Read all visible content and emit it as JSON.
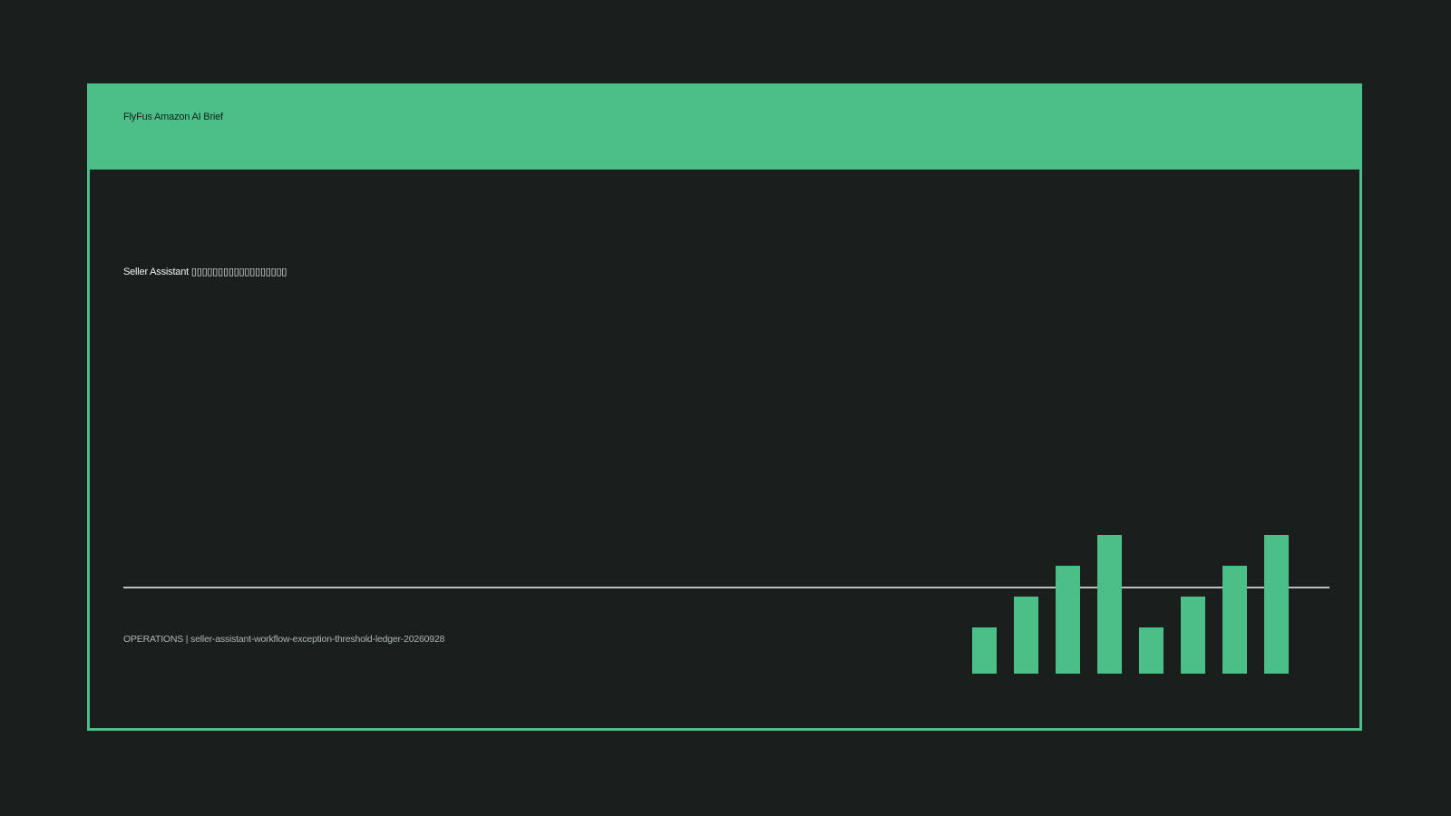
{
  "header": {
    "brand": "FlyFus Amazon AI Brief"
  },
  "main": {
    "headline": "Seller Assistant ▯▯▯▯▯▯▯▯▯▯▯▯▯▯▯▯▯▯"
  },
  "footer": {
    "text": "OPERATIONS | seller-assistant-workflow-exception-threshold-ledger-20260928"
  },
  "colors": {
    "accent": "#4bbf87",
    "background": "#1a1f1e",
    "rule": "#b9c0bd"
  },
  "chart_data": {
    "type": "bar",
    "values": [
      1.5,
      2.5,
      3.5,
      4.5,
      1.5,
      2.5,
      3.5,
      4.5
    ]
  }
}
